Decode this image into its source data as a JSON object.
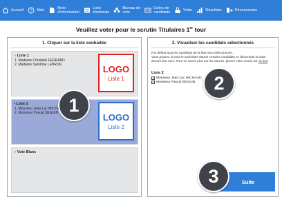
{
  "nav": {
    "items": [
      {
        "line1": "Accueil",
        "line2": "",
        "icon": "home-icon"
      },
      {
        "line1": "Aide",
        "line2": "",
        "icon": "help-icon"
      },
      {
        "line1": "Note",
        "line2": "d'information",
        "icon": "note-icon"
      },
      {
        "line1": "Liste",
        "line2": "électorale",
        "icon": "list-icon"
      },
      {
        "line1": "Bureau de",
        "line2": "vote",
        "icon": "bureau-icon"
      },
      {
        "line1": "Listes de",
        "line2": "candidats",
        "icon": "candidates-icon"
      },
      {
        "line1": "Voter",
        "line2": "",
        "icon": "vote-icon"
      },
      {
        "line1": "Résultats",
        "line2": "",
        "icon": "results-icon"
      },
      {
        "line1": "Déconnexion",
        "line2": "",
        "icon": "logout-icon"
      }
    ]
  },
  "title": {
    "prefix": "Veuillez voter pour le scrutin Titulaires 1",
    "sup": "er",
    "suffix": " tour"
  },
  "left_panel": {
    "heading": "1. Cliquer sur la liste souhaitée",
    "lists": [
      {
        "title": "○ Liste 1",
        "candidates": [
          "1. Madame Christelle FERRAND",
          "2. Madame Sandrine LEBRUN"
        ],
        "logo": "LOGO",
        "logo_sub": "Liste 1",
        "logo_color": "#e12020",
        "selected": false
      },
      {
        "title": "• Liste 2",
        "candidates": [
          "1. Monsieur Jean Luc MICHAUD",
          "2. Monsieur Pascal SEGUIN"
        ],
        "logo": "LOGO",
        "logo_sub": "Liste 2",
        "logo_color": "#2a6fc9",
        "selected": true
      },
      {
        "title": "○ Vote Blanc",
        "candidates": [],
        "selected": false
      }
    ]
  },
  "right_panel": {
    "heading": "2. Visualiser les candidats sélectionnés",
    "info_1": "Par défaut tous les candidats de la liste sont sélectionnés.",
    "info_2": "Vous pouvez si vous le souhaitez raturer certains candidats en décochant la case devant leur nom. Pour en savoir plus sur les ratures, placez votre souris sur",
    "info_link": "ce lien",
    "selection_title": "Liste 2",
    "selected_candidates": [
      "Monsieur Jean Luc MICHAUD",
      "Monsieur Pascal SEGUIN"
    ]
  },
  "suite_button": "Suite",
  "steps": [
    "1",
    "2",
    "3"
  ],
  "colors": {
    "accent": "#2f7fd8",
    "selected_list": "#9aa9d8",
    "step_circle": "#3f4349"
  }
}
